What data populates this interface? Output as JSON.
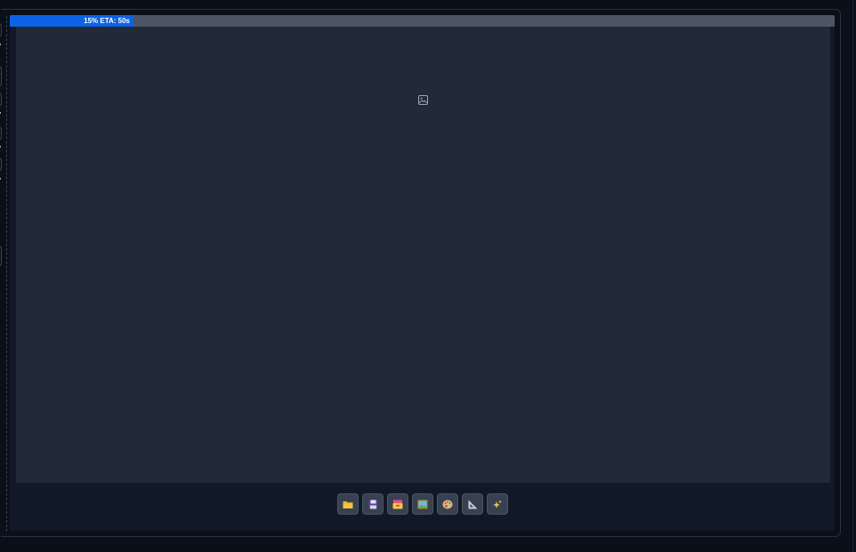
{
  "progress": {
    "percent": 15,
    "label": "15% ETA: 50s"
  },
  "image_area": {
    "placeholder_icon": "image-icon"
  },
  "toolbar": {
    "buttons": [
      {
        "icon": "folder-icon",
        "name": "open-folder-button",
        "color": "#f5c542"
      },
      {
        "icon": "floppy-disk-icon",
        "name": "save-button",
        "color": "#6b4fb8"
      },
      {
        "icon": "card-file-box-icon",
        "name": "send-to-button",
        "color": "#f5c542"
      },
      {
        "icon": "framed-picture-icon",
        "name": "send-to-img2img-button",
        "color": "#4caf50"
      },
      {
        "icon": "artist-palette-icon",
        "name": "send-to-inpaint-button",
        "color": "#e7b27a"
      },
      {
        "icon": "triangular-ruler-icon",
        "name": "send-to-extras-button",
        "color": "#8a94a6"
      },
      {
        "icon": "sparkles-icon",
        "name": "sparkles-button",
        "color": "#f5c542"
      }
    ]
  },
  "colors": {
    "background": "#0b0f19",
    "panel": "#111827",
    "image_area": "#222a38",
    "progress_fill": "#0b63e5",
    "progress_track": "#4b5563"
  }
}
